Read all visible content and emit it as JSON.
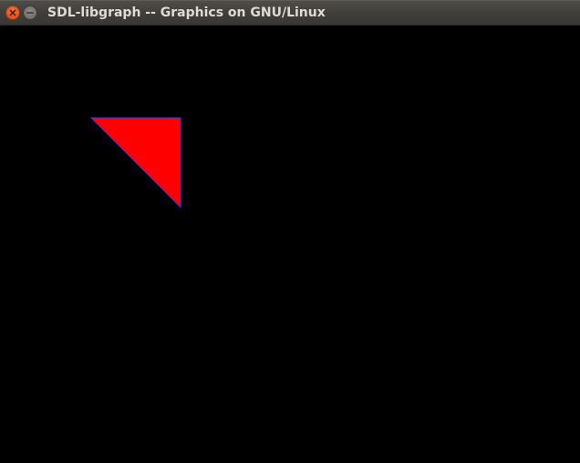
{
  "window": {
    "title": "SDL-libgraph -- Graphics on GNU/Linux",
    "close_icon": "close-icon",
    "minimize_icon": "minimize-icon"
  },
  "canvas": {
    "background": "#000000",
    "shapes": [
      {
        "type": "triangle",
        "fill": "#ff0000",
        "outline": "#3333ff"
      }
    ]
  }
}
